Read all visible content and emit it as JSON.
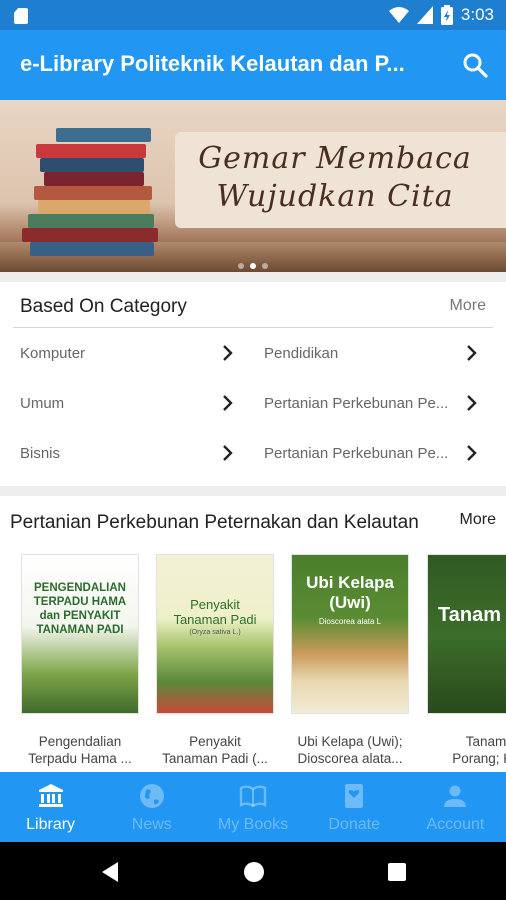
{
  "status": {
    "time": "3:03"
  },
  "appbar": {
    "title": "e-Library Politeknik Kelautan dan P..."
  },
  "banner": {
    "line1": "Gemar Membaca",
    "line2": "Wujudkan Cita"
  },
  "category": {
    "header": "Based On Category",
    "more": "More",
    "items": [
      {
        "label": "Komputer"
      },
      {
        "label": "Pendidikan"
      },
      {
        "label": "Umum"
      },
      {
        "label": "Pertanian Perkebunan Pe..."
      },
      {
        "label": "Bisnis"
      },
      {
        "label": "Pertanian Perkebunan Pe..."
      }
    ]
  },
  "books": {
    "title": "Pertanian Perkebunan Peternakan dan Kelautan",
    "more": "More",
    "items": [
      {
        "cover_title": "PENGENDALIAN TERPADU HAMA dan PENYAKIT TANAMAN PADI",
        "caption_1": "Pengendalian",
        "caption_2": "Terpadu Hama ..."
      },
      {
        "cover_title": "Penyakit Tanaman Padi",
        "cover_sub": "(Oryza sativa L.)",
        "caption_1": "Penyakit",
        "caption_2": "Tanaman Padi (..."
      },
      {
        "cover_title": "Ubi Kelapa (Uwi)",
        "cover_sub": "Dioscorea alata L",
        "caption_1": "Ubi Kelapa (Uwi);",
        "caption_2": "Dioscorea alata..."
      },
      {
        "cover_title": "Tanam Poran",
        "caption_1": "Tanam",
        "caption_2": "Porang; Ka"
      }
    ]
  },
  "nav": {
    "items": [
      {
        "label": "Library"
      },
      {
        "label": "News"
      },
      {
        "label": "My Books"
      },
      {
        "label": "Donate"
      },
      {
        "label": "Account"
      }
    ]
  }
}
